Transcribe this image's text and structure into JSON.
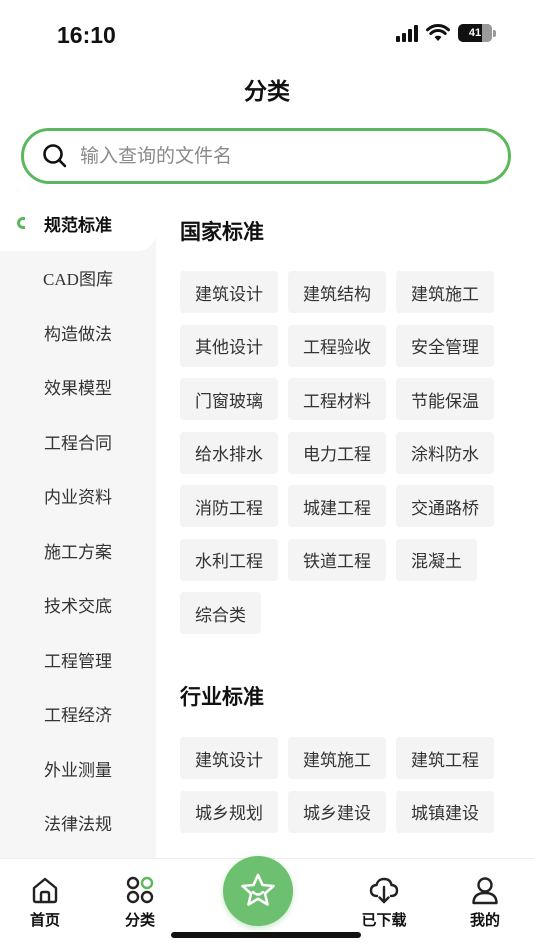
{
  "status_bar": {
    "time": "16:10",
    "battery_level": "41"
  },
  "header": {
    "title": "分类"
  },
  "search": {
    "placeholder": "输入查询的文件名"
  },
  "sidebar": {
    "active_index": 0,
    "items": [
      {
        "label": "规范标准"
      },
      {
        "label": "CAD图库"
      },
      {
        "label": "构造做法"
      },
      {
        "label": "效果模型"
      },
      {
        "label": "工程合同"
      },
      {
        "label": "内业资料"
      },
      {
        "label": "施工方案"
      },
      {
        "label": "技术交底"
      },
      {
        "label": "工程管理"
      },
      {
        "label": "工程经济"
      },
      {
        "label": "外业测量"
      },
      {
        "label": "法律法规"
      }
    ]
  },
  "sections": [
    {
      "title": "国家标准",
      "tags": [
        "建筑设计",
        "建筑结构",
        "建筑施工",
        "其他设计",
        "工程验收",
        "安全管理",
        "门窗玻璃",
        "工程材料",
        "节能保温",
        "给水排水",
        "电力工程",
        "涂料防水",
        "消防工程",
        "城建工程",
        "交通路桥",
        "水利工程",
        "铁道工程",
        "混凝土",
        "综合类"
      ]
    },
    {
      "title": "行业标准",
      "tags": [
        "建筑设计",
        "建筑施工",
        "建筑工程",
        "城乡规划",
        "城乡建设",
        "城镇建设"
      ]
    }
  ],
  "tab_bar": {
    "home": "首页",
    "category": "分类",
    "download": "已下载",
    "mine": "我的"
  },
  "colors": {
    "accent": "#5cb85c",
    "center_button": "#6cc070"
  }
}
